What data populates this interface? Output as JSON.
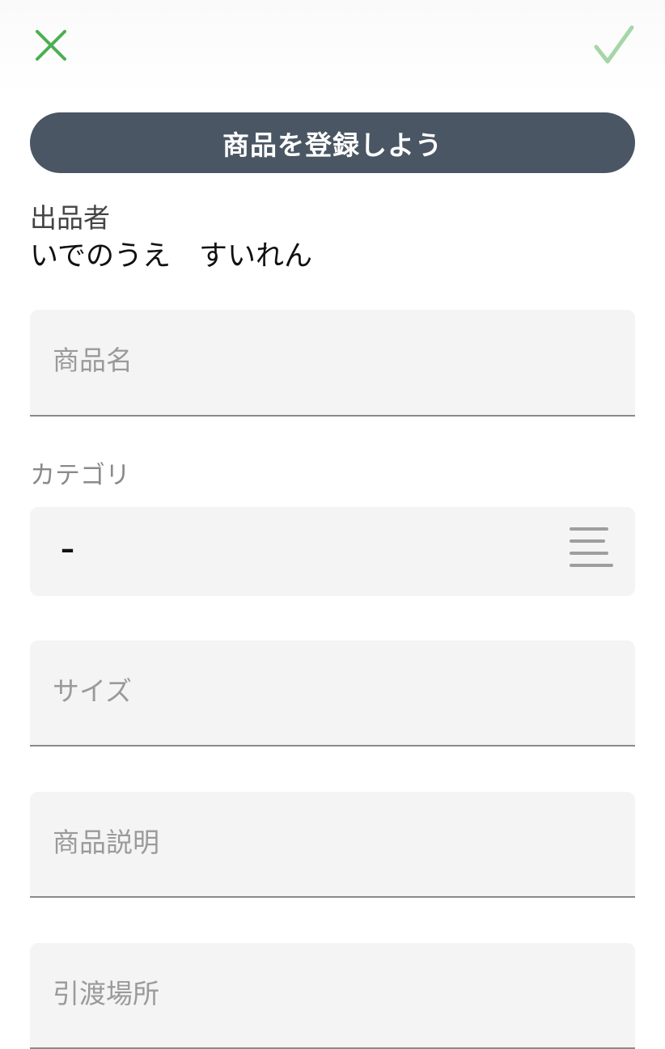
{
  "header": {
    "close_icon": "close-icon",
    "confirm_icon": "checkmark-icon",
    "close_color": "#4caf50",
    "confirm_color": "#a5d6a7"
  },
  "banner": {
    "title": "商品を登録しよう",
    "background": "#4a5663"
  },
  "seller": {
    "label": "出品者",
    "name": "いでのうえ　すいれん"
  },
  "form": {
    "product_name": {
      "placeholder": "商品名"
    },
    "category": {
      "label": "カテゴリ",
      "value": "–",
      "icon": "menu-icon"
    },
    "size": {
      "placeholder": "サイズ"
    },
    "description": {
      "placeholder": "商品説明"
    },
    "handover_location": {
      "placeholder": "引渡場所"
    }
  }
}
